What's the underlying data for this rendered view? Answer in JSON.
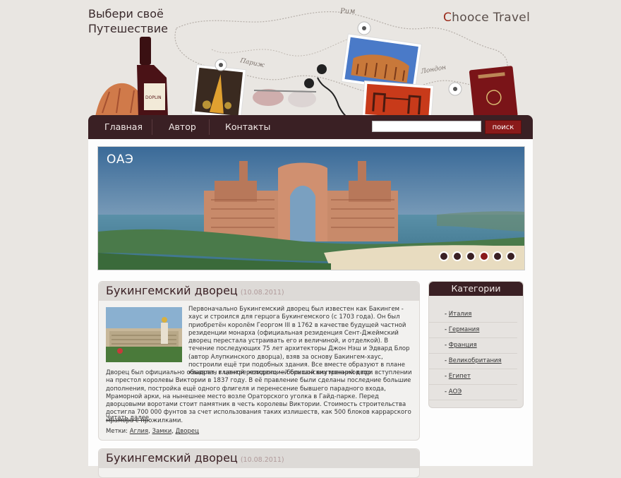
{
  "header": {
    "slogan_line1": "Выбери своё",
    "slogan_line2": "Путешествие",
    "brand_first_letter": "C",
    "brand_rest": "hooce Travel",
    "map_labels": [
      "Рим",
      "Париж",
      "Лондон"
    ],
    "wine_label": "DOPLIN"
  },
  "nav": {
    "items": [
      "Главная",
      "Автор",
      "Контакты"
    ],
    "search_placeholder": "",
    "search_button": "поиск"
  },
  "slider": {
    "title": "ОАЭ",
    "dots": 6,
    "active_dot": 4
  },
  "posts": [
    {
      "title": "Букингемский дворец",
      "date": "(10.08.2011)",
      "lead": "Первоначально Букингемский дворец был известен как Бакингем - хаус и строился для герцога Букингемского (с 1703 года). Он был приобретён королём Георгом III в 1762 в качестве будущей частной резиденции монарха (официальная резиденция Сент-Джеймский дворец перестала устраивать его и величиной, и отделкой). В течение последующих 75 лет архитекторы Джон Нэш и Эдвард Блор (автор Алупкинского дворца), взяв за основу Бакингем-хаус, построили ещё три подобных здания. Все вместе образуют в плане квадрат, в центре которого — большой внутренний двор.",
      "body": "Дворец был официально объявлен главной резиденцией британских монархов при вступлении на престол королевы Виктории в 1837 году. В её правление были сделаны последние большие дополнения, постройка ещё одного флигеля и перенесение бывшего парадного входа, Мраморной арки, на нынешнее место возле Ораторского уголка в Гайд-парке. Перед дворцовыми воротами стоит памятник в честь королевы Виктории. Стоимость строительства достигла 700 000 фунтов за счет использования таких излишеств, как 500 блоков каррарского мрамора с прожилками.",
      "read_more": "Читать далее",
      "tags_label": "Метки:",
      "tags": [
        "Аглия",
        "Замки",
        "Дворец"
      ]
    },
    {
      "title": "Букингемский дворец",
      "date": "(10.08.2011)"
    }
  ],
  "sidebar": {
    "title": "Категории",
    "categories": [
      "Италия",
      "Германия",
      "Франция",
      "Великобритания",
      "Египет",
      "АОЭ"
    ]
  },
  "colors": {
    "nav_bg": "#3a2024",
    "accent_red": "#8a1a1a",
    "page_bg": "#e9e6e2"
  }
}
